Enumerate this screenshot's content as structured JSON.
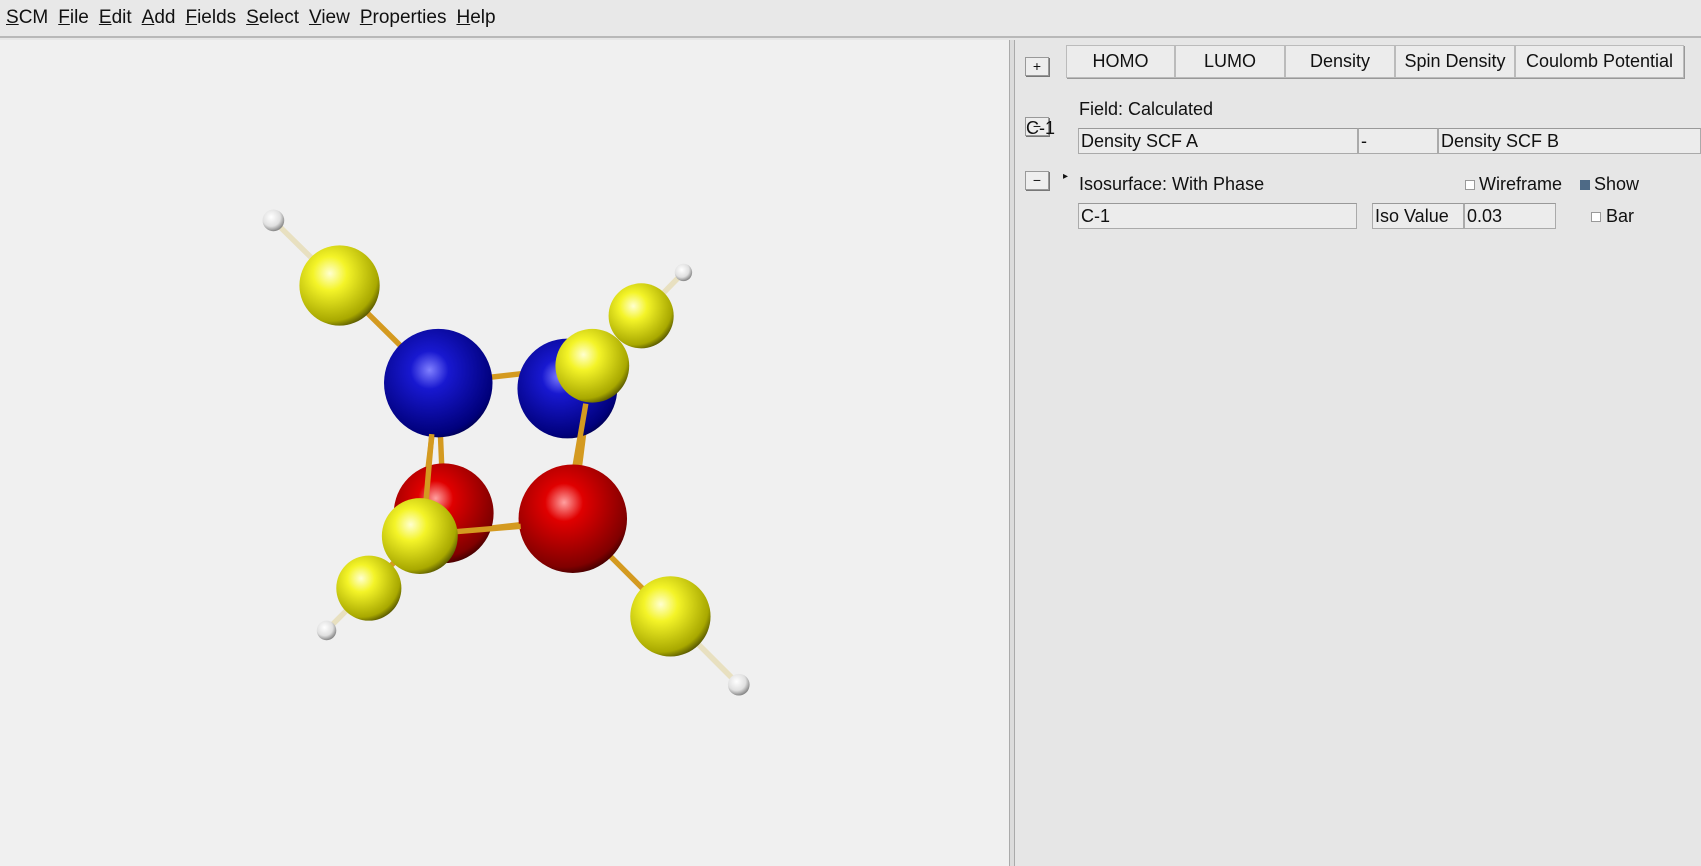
{
  "menu": [
    {
      "u": "S",
      "rest": "CM"
    },
    {
      "u": "F",
      "rest": "ile"
    },
    {
      "u": "E",
      "rest": "dit"
    },
    {
      "u": "A",
      "rest": "dd"
    },
    {
      "u": "F",
      "rest": "ields"
    },
    {
      "u": "S",
      "rest": "elect"
    },
    {
      "u": "V",
      "rest": "iew"
    },
    {
      "u": "P",
      "rest": "roperties"
    },
    {
      "u": "H",
      "rest": "elp"
    }
  ],
  "panel": {
    "add_button": "+",
    "tabs": [
      "HOMO",
      "LUMO",
      "Density",
      "Spin Density",
      "Coulomb Potential"
    ],
    "field": {
      "collapse_button": "−",
      "title": "Field: Calculated",
      "label": "C-1",
      "operand_a": "Density SCF A",
      "operator": "-",
      "operand_b": "Density SCF B"
    },
    "isosurface": {
      "collapse_button": "−",
      "title": "Isosurface: With Phase",
      "wireframe_label": "Wireframe",
      "wireframe_checked": false,
      "show_label": "Show",
      "show_checked": true,
      "field_name": "C-1",
      "iso_label": "Iso Value",
      "iso_value": "0.03",
      "bar_label": "Bar",
      "bar_checked": false
    }
  },
  "colors": {
    "positive_lobe": "#1010c0",
    "negative_lobe": "#d00000",
    "atom": "#f0f020",
    "hydrogen": "#ffffff",
    "bond": "#d49a20"
  }
}
